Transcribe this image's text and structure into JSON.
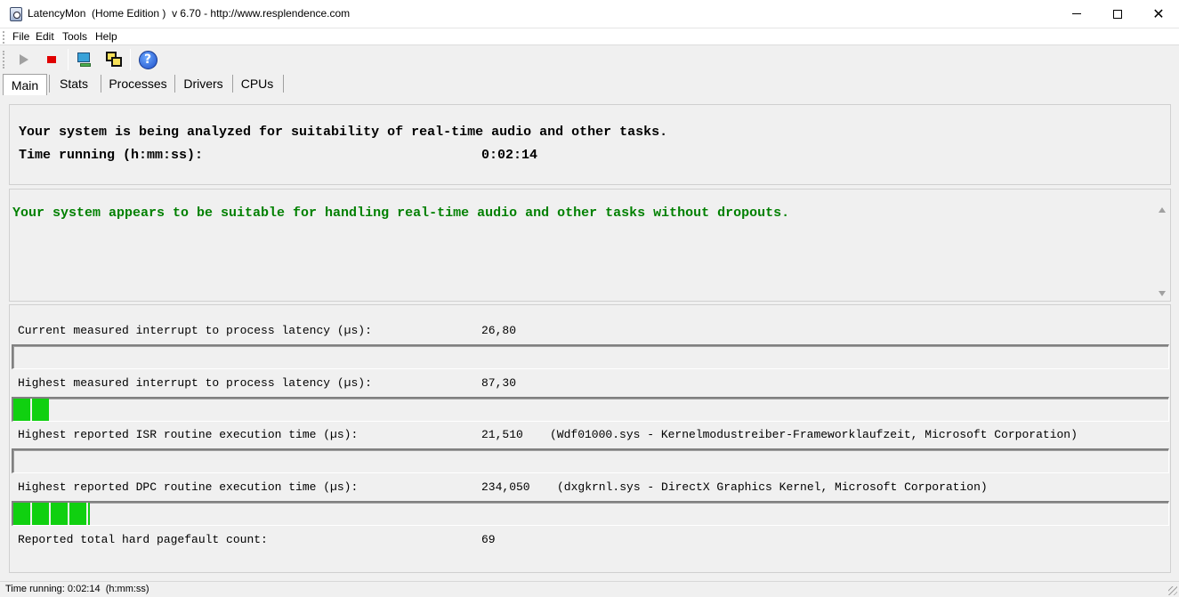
{
  "window": {
    "title": "LatencyMon  (Home Edition )  v 6.70 - http://www.resplendence.com"
  },
  "menu": [
    "File",
    "Edit",
    "Tools",
    "Help"
  ],
  "toolbar": {
    "icons": [
      "play-icon",
      "stop-icon",
      "monitor-icon",
      "windows-icon",
      "help-icon"
    ],
    "help_glyph": "?"
  },
  "tabs": [
    {
      "label": "Main",
      "active": true
    },
    {
      "label": "Stats",
      "active": false
    },
    {
      "label": "Processes",
      "active": false
    },
    {
      "label": "Drivers",
      "active": false
    },
    {
      "label": "CPUs",
      "active": false
    }
  ],
  "summary": {
    "analyzing": "Your system is being analyzed for suitability of real-time audio and other tasks.",
    "time_label": "Time running (h:mm:ss):",
    "time_value": "0:02:14"
  },
  "verdict": {
    "text": "Your system appears to be suitable for handling real-time audio and other tasks without dropouts.",
    "color": "#008000"
  },
  "metrics": [
    {
      "label": "Current measured interrupt to process latency (µs):",
      "value": "26,80",
      "source": "",
      "bar_fraction": 0.0
    },
    {
      "label": "Highest measured interrupt to process latency (µs):",
      "value": "87,30",
      "source": "",
      "bar_fraction": 0.031
    },
    {
      "label": "Highest reported ISR routine execution time (µs):",
      "value": "21,510",
      "source": "(Wdf01000.sys - Kernelmodustreiber-Frameworklaufzeit, Microsoft Corporation)",
      "bar_fraction": 0.0
    },
    {
      "label": "Highest reported DPC routine execution time (µs):",
      "value": "234,050",
      "source": "(dxgkrnl.sys - DirectX Graphics Kernel, Microsoft Corporation)",
      "bar_fraction": 0.066
    },
    {
      "label": "Reported total hard pagefault count:",
      "value": "69",
      "source": ""
    }
  ],
  "status_bar": "Time running: 0:02:14  (h:mm:ss)",
  "colors": {
    "bar_fill": "#10d010",
    "stop": "#e00000"
  }
}
